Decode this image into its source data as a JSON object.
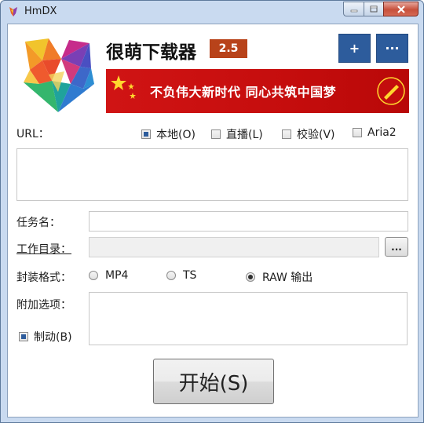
{
  "window": {
    "title": "HmDX"
  },
  "header": {
    "app_name": "很萌下载器",
    "version": "2.5",
    "add_label": "+",
    "more_label": "···",
    "banner_text": "不负伟大新时代 同心共筑中国梦"
  },
  "url_section": {
    "label": "URL：",
    "options": [
      {
        "label": "本地(O)",
        "checked": true
      },
      {
        "label": "直播(L)",
        "checked": false
      },
      {
        "label": "校验(V)",
        "checked": false
      },
      {
        "label": "Aria2",
        "checked": false
      }
    ],
    "value": ""
  },
  "task_name": {
    "label": "任务名：",
    "value": ""
  },
  "work_dir": {
    "label": "工作目录：",
    "value": "",
    "browse_label": "..."
  },
  "format": {
    "label": "封装格式：",
    "options": [
      {
        "label": "MP4",
        "selected": false
      },
      {
        "label": "TS",
        "selected": false
      },
      {
        "label": "RAW 输出",
        "selected": true
      }
    ]
  },
  "extra": {
    "label": "附加选项：",
    "value": ""
  },
  "force": {
    "label": "制动(B)",
    "checked": true
  },
  "start_button": {
    "label": "开始(S)"
  },
  "colors": {
    "accent": "#2d5c9c",
    "version_bg": "#b8431a",
    "banner": "#d01414"
  }
}
